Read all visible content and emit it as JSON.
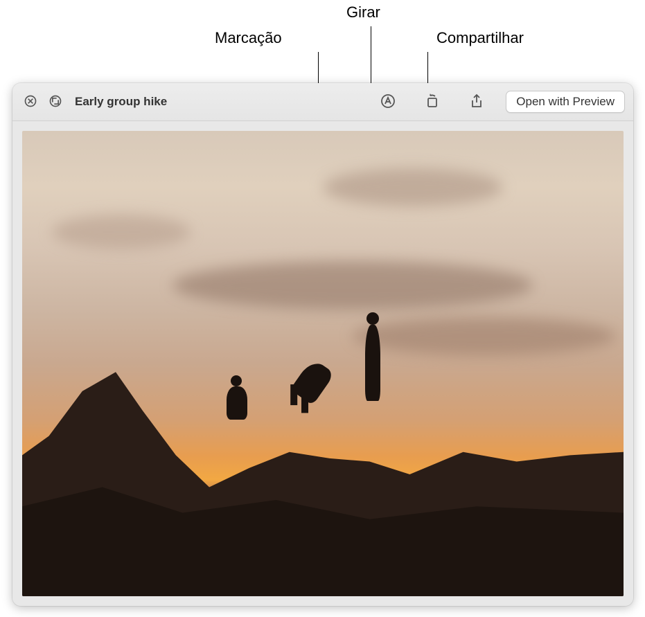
{
  "annotations": {
    "markup": "Marcação",
    "rotate": "Girar",
    "share": "Compartilhar"
  },
  "toolbar": {
    "title": "Early group hike",
    "open_with_preview_label": "Open with Preview"
  },
  "icons": {
    "close": "close-icon",
    "noentry": "full-screen-icon",
    "markup": "markup-icon",
    "rotate": "rotate-icon",
    "share": "share-icon"
  }
}
